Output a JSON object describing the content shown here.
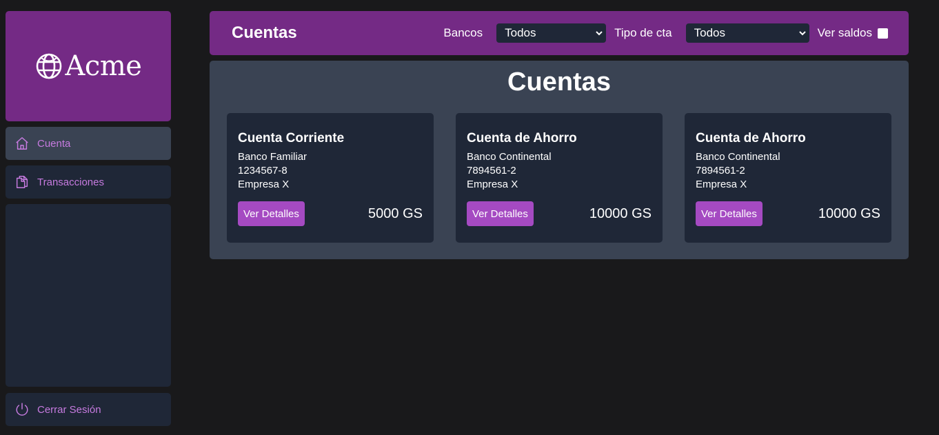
{
  "brand": {
    "name": "Acme",
    "icon": "globe-icon"
  },
  "sidebar": {
    "items": [
      {
        "label": "Cuenta",
        "icon": "home-icon",
        "active": true
      },
      {
        "label": "Transacciones",
        "icon": "copy-icon",
        "active": false
      }
    ],
    "logout": {
      "label": "Cerrar Sesión",
      "icon": "power-icon"
    }
  },
  "header": {
    "title": "Cuentas",
    "bancos_label": "Bancos",
    "bancos_value": "Todos",
    "tipo_label": "Tipo de cta",
    "tipo_value": "Todos",
    "saldos_label": "Ver saldos",
    "saldos_checked": false
  },
  "main": {
    "title": "Cuentas",
    "cards": [
      {
        "type": "Cuenta Corriente",
        "bank": "Banco Familiar",
        "number": "1234567-8",
        "holder": "Empresa X",
        "button": "Ver Detalles",
        "amount": "5000 GS"
      },
      {
        "type": "Cuenta de Ahorro",
        "bank": "Banco Continental",
        "number": "7894561-2",
        "holder": "Empresa X",
        "button": "Ver Detalles",
        "amount": "10000 GS"
      },
      {
        "type": "Cuenta de Ahorro",
        "bank": "Banco Continental",
        "number": "7894561-2",
        "holder": "Empresa X",
        "button": "Ver Detalles",
        "amount": "10000 GS"
      }
    ]
  },
  "colors": {
    "background": "#19191b",
    "accent": "#742a85",
    "button": "#a54ac2",
    "card": "#1f2737",
    "panel": "#3a4353",
    "nav_text": "#c77be0"
  }
}
